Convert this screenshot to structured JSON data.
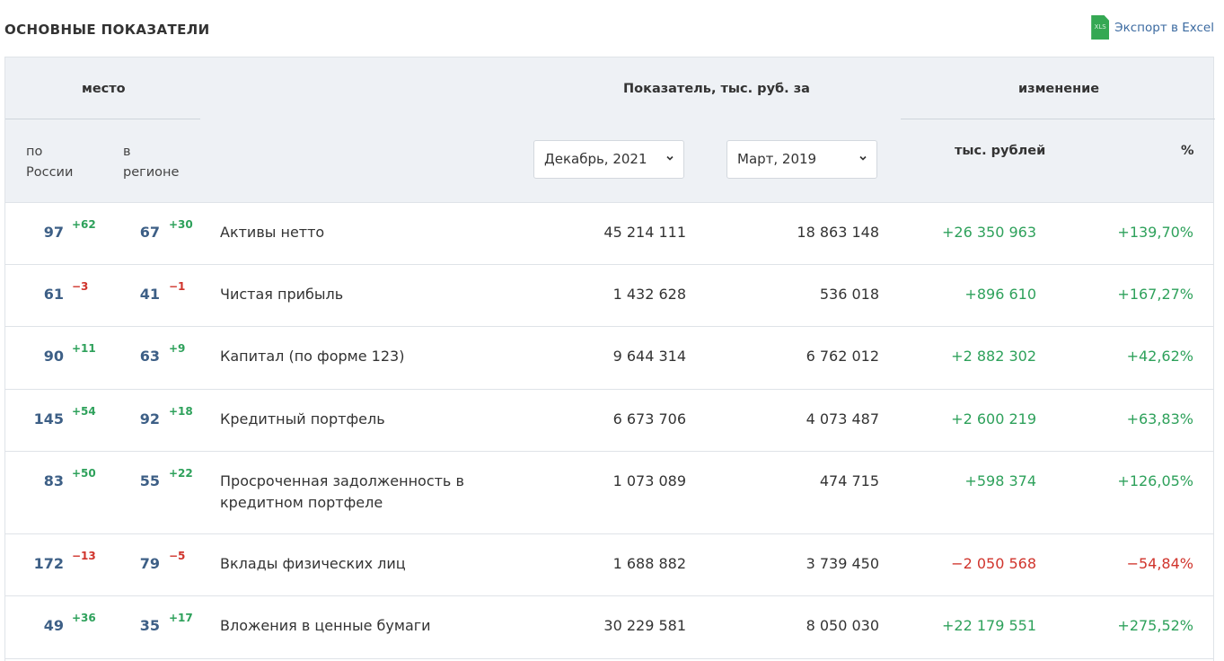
{
  "title": "ОСНОВНЫЕ ПОКАЗАТЕЛИ",
  "export": {
    "icon_text": "XLS",
    "label": "Экспорт в Excel",
    "icon": "xls-file-icon",
    "icon_color": "#35a853"
  },
  "header": {
    "place": "место",
    "indicator": "Показатель, тыс. руб. за",
    "change": "изменение",
    "russia": "по\nРоссии",
    "region": "в\nрегионе",
    "thousand_rub": "тыс. рублей",
    "percent": "%"
  },
  "selects": {
    "period1": "Декабрь, 2021",
    "period2": "Март, 2019"
  },
  "colors": {
    "positive": "#2ea15b",
    "negative": "#d0342c",
    "rank": "#3d5f86",
    "header_bg": "#eef1f5"
  },
  "rows": [
    {
      "rank_russia": "97",
      "delta_russia": "+62",
      "rank_region": "67",
      "delta_region": "+30",
      "name": "Активы нетто",
      "val1": "45 214 111",
      "val2": "18 863 148",
      "chg_abs": "+26 350 963",
      "chg_pct": "+139,70%"
    },
    {
      "rank_russia": "61",
      "delta_russia": "−3",
      "rank_region": "41",
      "delta_region": "−1",
      "name": "Чистая прибыль",
      "val1": "1 432 628",
      "val2": "536 018",
      "chg_abs": "+896 610",
      "chg_pct": "+167,27%"
    },
    {
      "rank_russia": "90",
      "delta_russia": "+11",
      "rank_region": "63",
      "delta_region": "+9",
      "name": "Капитал (по форме 123)",
      "val1": "9 644 314",
      "val2": "6 762 012",
      "chg_abs": "+2 882 302",
      "chg_pct": "+42,62%"
    },
    {
      "rank_russia": "145",
      "delta_russia": "+54",
      "rank_region": "92",
      "delta_region": "+18",
      "name": "Кредитный портфель",
      "val1": "6 673 706",
      "val2": "4 073 487",
      "chg_abs": "+2 600 219",
      "chg_pct": "+63,83%"
    },
    {
      "rank_russia": "83",
      "delta_russia": "+50",
      "rank_region": "55",
      "delta_region": "+22",
      "name": "Просроченная задолженность в кредитном портфеле",
      "val1": "1 073 089",
      "val2": "474 715",
      "chg_abs": "+598 374",
      "chg_pct": "+126,05%"
    },
    {
      "rank_russia": "172",
      "delta_russia": "−13",
      "rank_region": "79",
      "delta_region": "−5",
      "name": "Вклады физических лиц",
      "val1": "1 688 882",
      "val2": "3 739 450",
      "chg_abs": "−2 050 568",
      "chg_pct": "−54,84%"
    },
    {
      "rank_russia": "49",
      "delta_russia": "+36",
      "rank_region": "35",
      "delta_region": "+17",
      "name": "Вложения в ценные бумаги",
      "val1": "30 229 581",
      "val2": "8 050 030",
      "chg_abs": "+22 179 551",
      "chg_pct": "+275,52%"
    }
  ]
}
